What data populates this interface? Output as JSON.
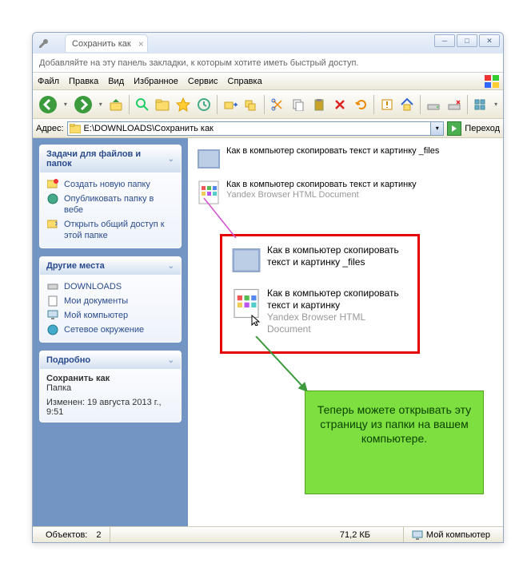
{
  "tab_title": "Сохранить как",
  "bookmark_hint": "Добавляйте на эту панель закладки, к которым хотите иметь быстрый доступ.",
  "menu": {
    "file": "Файл",
    "edit": "Правка",
    "view": "Вид",
    "favorites": "Избранное",
    "tools": "Сервис",
    "help": "Справка"
  },
  "address_label": "Адрес:",
  "address_value": "E:\\DOWNLOADS\\Сохранить как",
  "go_label": "Переход",
  "sidebar": {
    "tasks": {
      "title": "Задачи для файлов и папок",
      "items": [
        "Создать новую папку",
        "Опубликовать папку в вебе",
        "Открыть общий доступ к этой папке"
      ]
    },
    "places": {
      "title": "Другие места",
      "items": [
        "DOWNLOADS",
        "Мои документы",
        "Мой компьютер",
        "Сетевое окружение"
      ]
    },
    "details": {
      "title": "Подробно",
      "name": "Сохранить как",
      "type": "Папка",
      "modified_label": "Изменен:",
      "modified_value": "19 августа 2013 г., 9:51"
    }
  },
  "files": [
    {
      "name": "Как в компьютер скопировать текст и картинку _files",
      "sub": ""
    },
    {
      "name": "Как в компьютер скопировать текст и картинку",
      "sub": "Yandex Browser HTML Document"
    }
  ],
  "highlighted": [
    {
      "name": "Как в компьютер скопировать текст и картинку _files",
      "sub": ""
    },
    {
      "name": "Как в компьютер скопировать текст и картинку",
      "sub": "Yandex Browser HTML Document"
    }
  ],
  "callout_text": "Теперь можете открывать эту страницу из папки на вашем компьютере.",
  "status": {
    "objects_label": "Объектов:",
    "objects_count": "2",
    "size": "71,2 КБ",
    "location": "Мой компьютер"
  }
}
